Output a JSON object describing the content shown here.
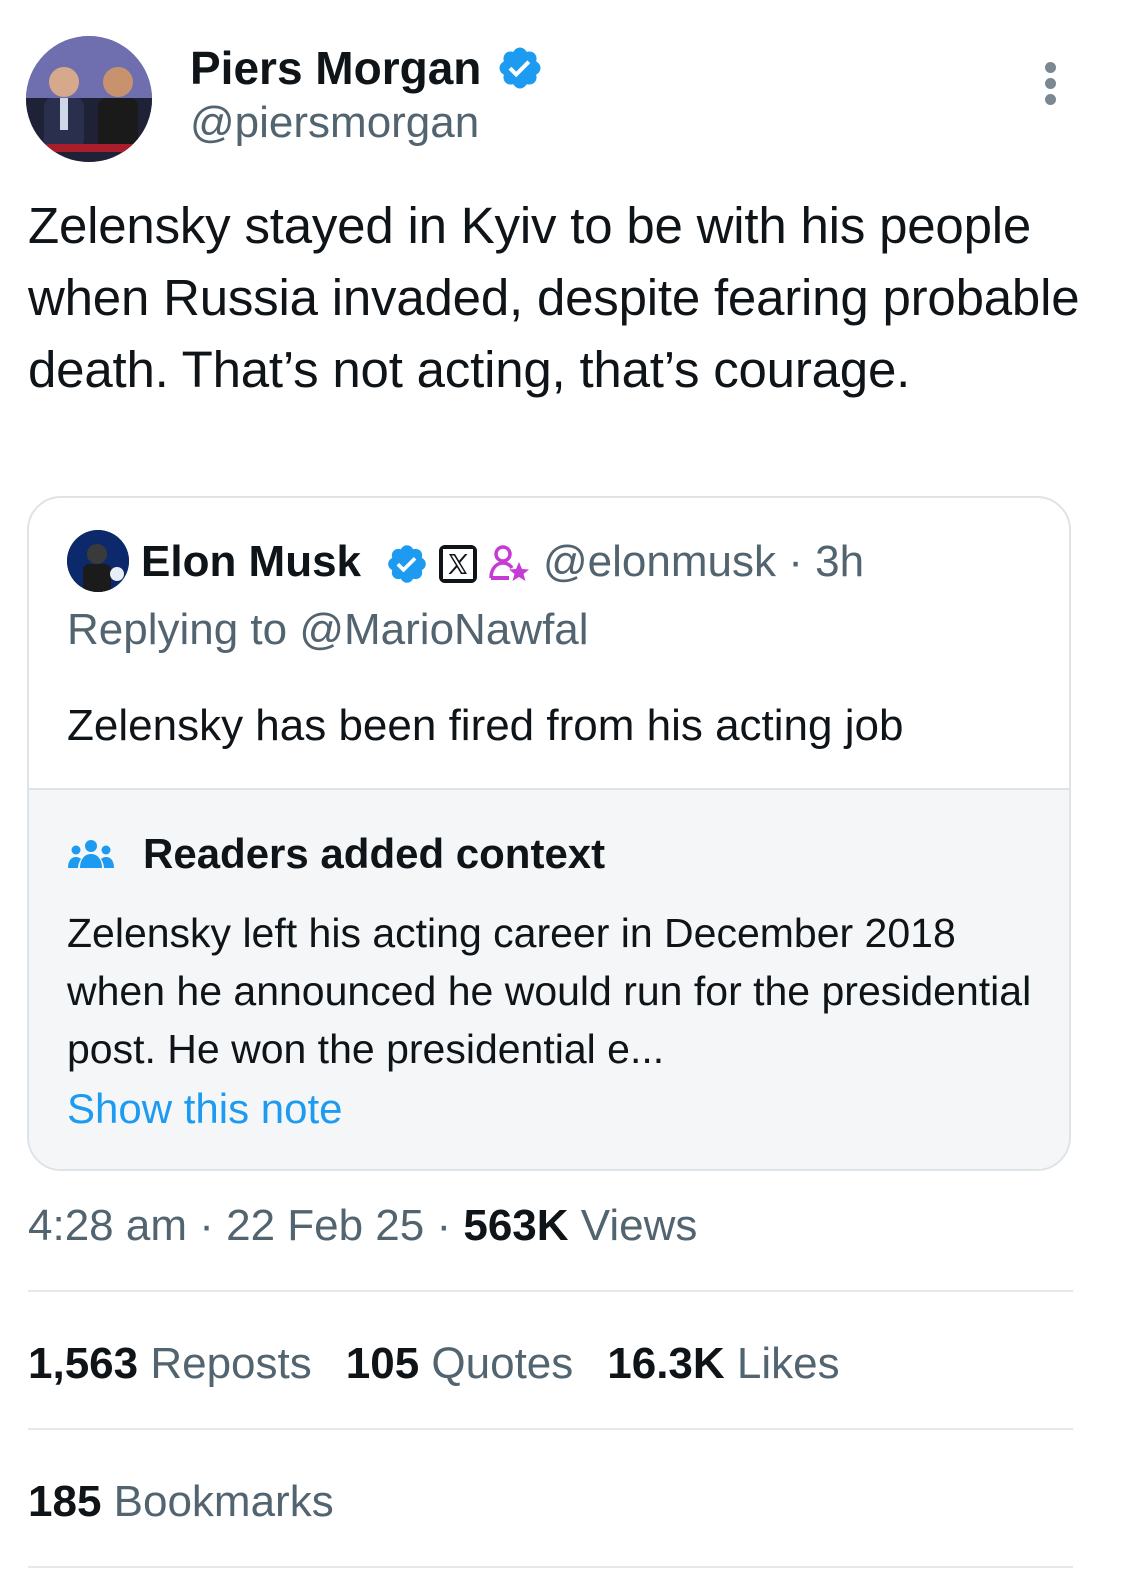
{
  "author": {
    "display_name": "Piers Morgan",
    "handle": "@piersmorgan",
    "verified": true,
    "avatar_icon": "profile-photo"
  },
  "tweet": {
    "text": "Zelensky stayed in Kyiv to be with his people when Russia invaded, despite fearing probable death. That’s not acting, that’s courage."
  },
  "quoted": {
    "display_name": "Elon Musk",
    "handle": "@elonmusk",
    "separator": " · ",
    "age": "3h",
    "reply_prefix": "Replying to ",
    "reply_to": "@MarioNawfal",
    "text": "Zelensky has been fired from his acting job",
    "badges": [
      "verified-icon",
      "x-logo-icon",
      "government-affiliation-icon"
    ]
  },
  "context_note": {
    "title": "Readers added context",
    "body": "Zelensky left his acting career in December 2018 when he announced he would run for the presidential post. He won the presidential e...",
    "link": "Show this note"
  },
  "meta": {
    "time": "4:28 am",
    "date": "22 Feb 25",
    "views_count": "563K",
    "views_label": " Views",
    "separator": " · "
  },
  "stats": {
    "reposts_count": "1,563",
    "reposts_label": " Reposts",
    "quotes_count": "105",
    "quotes_label": " Quotes",
    "likes_count": "16.3K",
    "likes_label": " Likes",
    "bookmarks_count": "185",
    "bookmarks_label": " Bookmarks"
  },
  "colors": {
    "verified_blue": "#1d9bf0",
    "text_primary": "#0f1419",
    "text_secondary": "#536471",
    "context_bg": "#f4f6f7",
    "gov_badge_purple": "#c63bd3"
  }
}
